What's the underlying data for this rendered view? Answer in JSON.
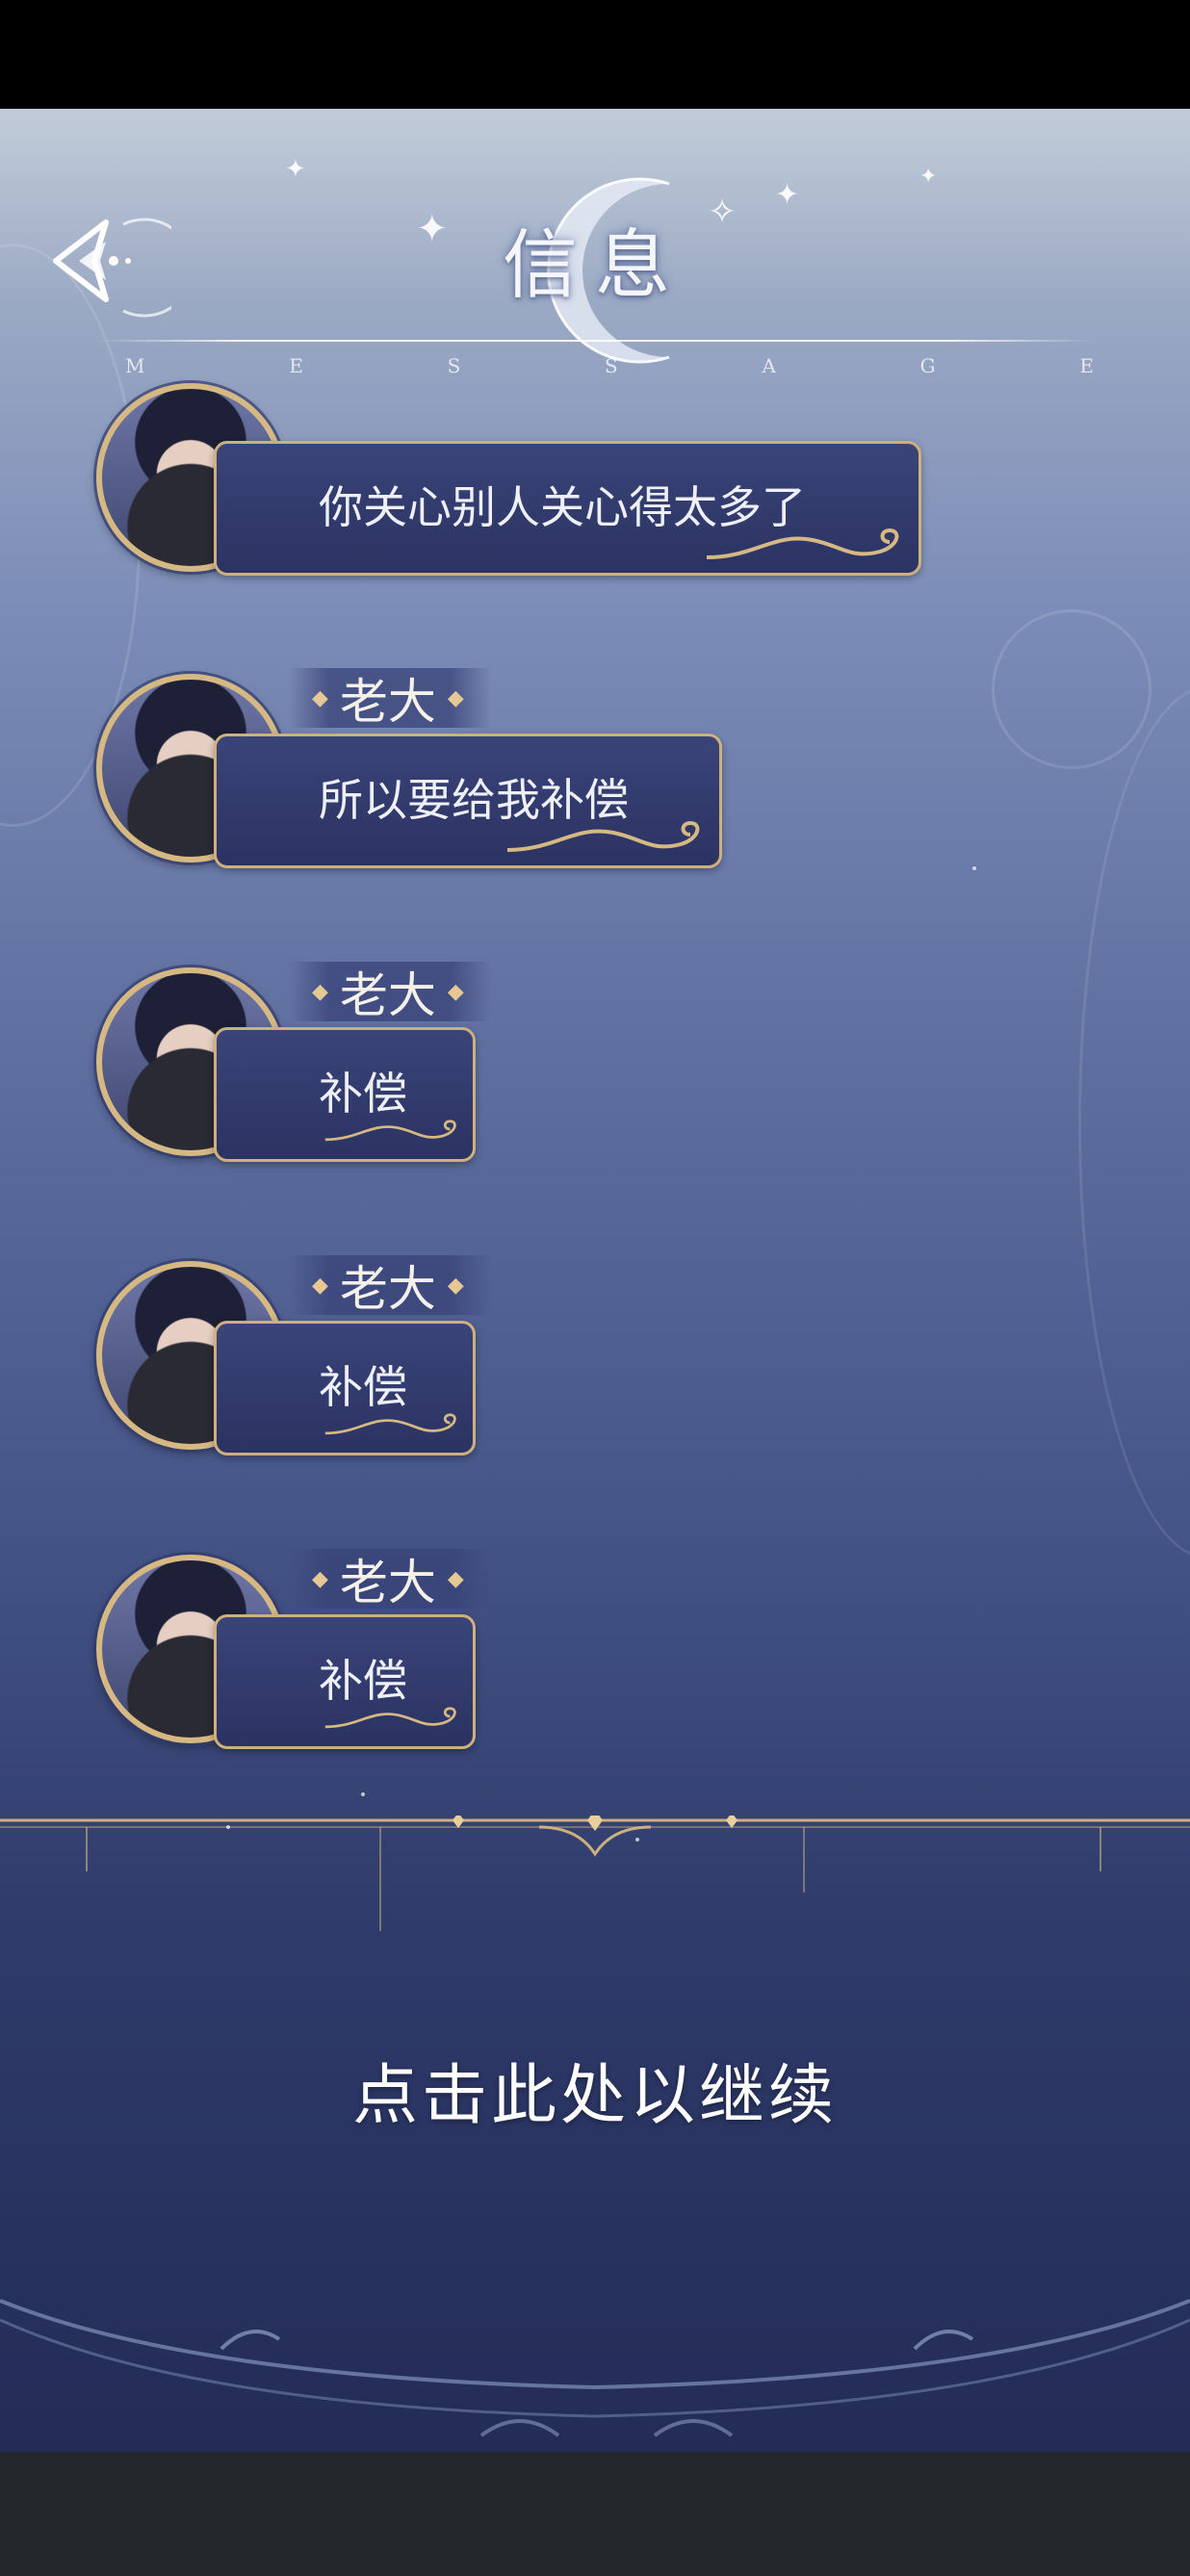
{
  "header": {
    "title": "信息",
    "subtitle_letters": [
      "M",
      "E",
      "S",
      "S",
      "A",
      "G",
      "E"
    ]
  },
  "messages": [
    {
      "sender": "",
      "text": "你关心别人关心得太多了"
    },
    {
      "sender": "老大",
      "text": "所以要给我补偿"
    },
    {
      "sender": "老大",
      "text": "补偿"
    },
    {
      "sender": "老大",
      "text": "补偿"
    },
    {
      "sender": "老大",
      "text": "补偿"
    }
  ],
  "footer": {
    "continue_label": "点击此处以继续"
  },
  "icons": {
    "back": "back-arrow-icon",
    "moon": "crescent-moon-icon",
    "sparkle": "sparkle-icon",
    "flourish": "gold-flourish-icon"
  },
  "colors": {
    "gold": "#d6b882",
    "bubble": "#2f3768",
    "text": "#eef0f7"
  }
}
